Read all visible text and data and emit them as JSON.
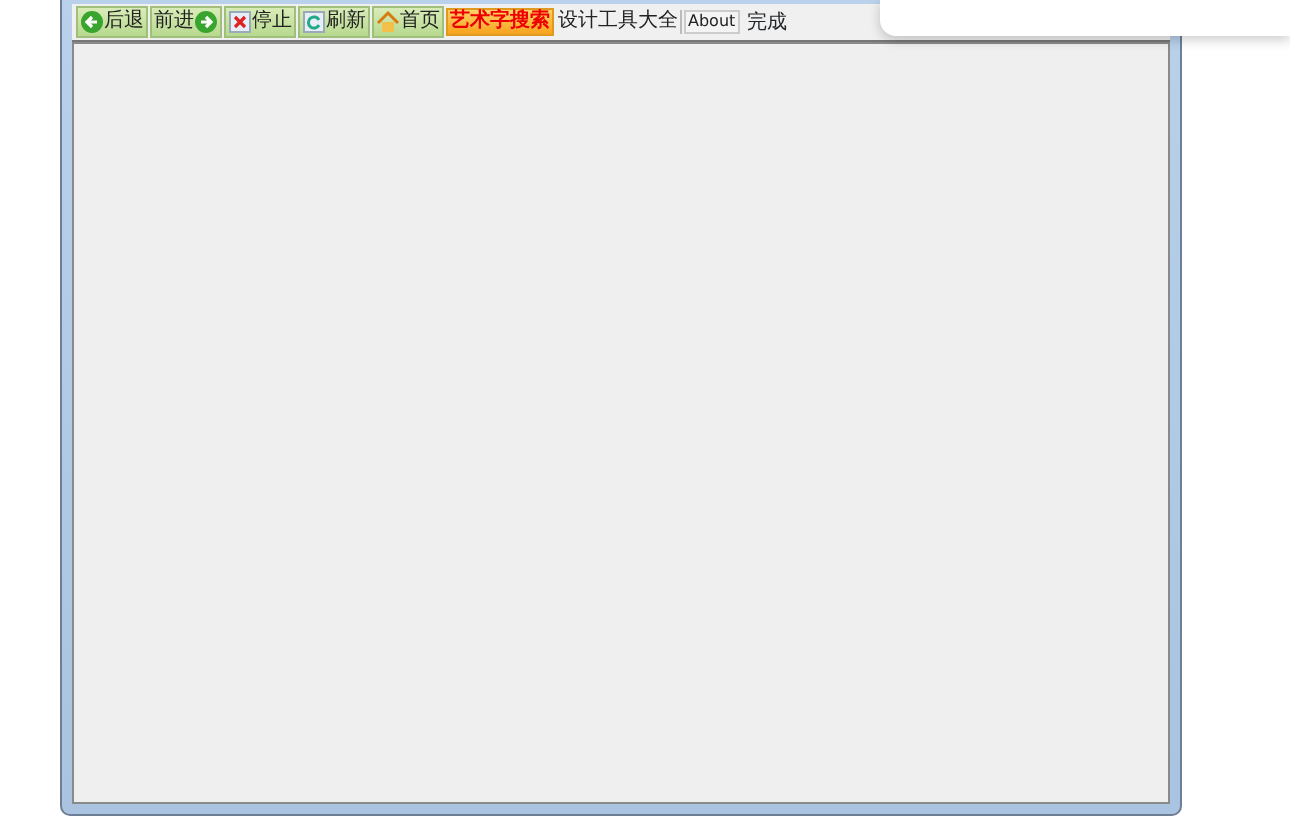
{
  "toolbar": {
    "buttons": [
      {
        "kind": "back",
        "label": "后退"
      },
      {
        "kind": "forward",
        "label": "前进"
      },
      {
        "kind": "stop",
        "label": "停止"
      },
      {
        "kind": "refresh",
        "label": "刷新"
      },
      {
        "kind": "home",
        "label": "首页"
      },
      {
        "kind": "highlight",
        "label": "艺术字搜索"
      },
      {
        "kind": "plain",
        "label": "设计工具大全"
      },
      {
        "kind": "small",
        "label": "About"
      }
    ]
  },
  "status": "完成"
}
